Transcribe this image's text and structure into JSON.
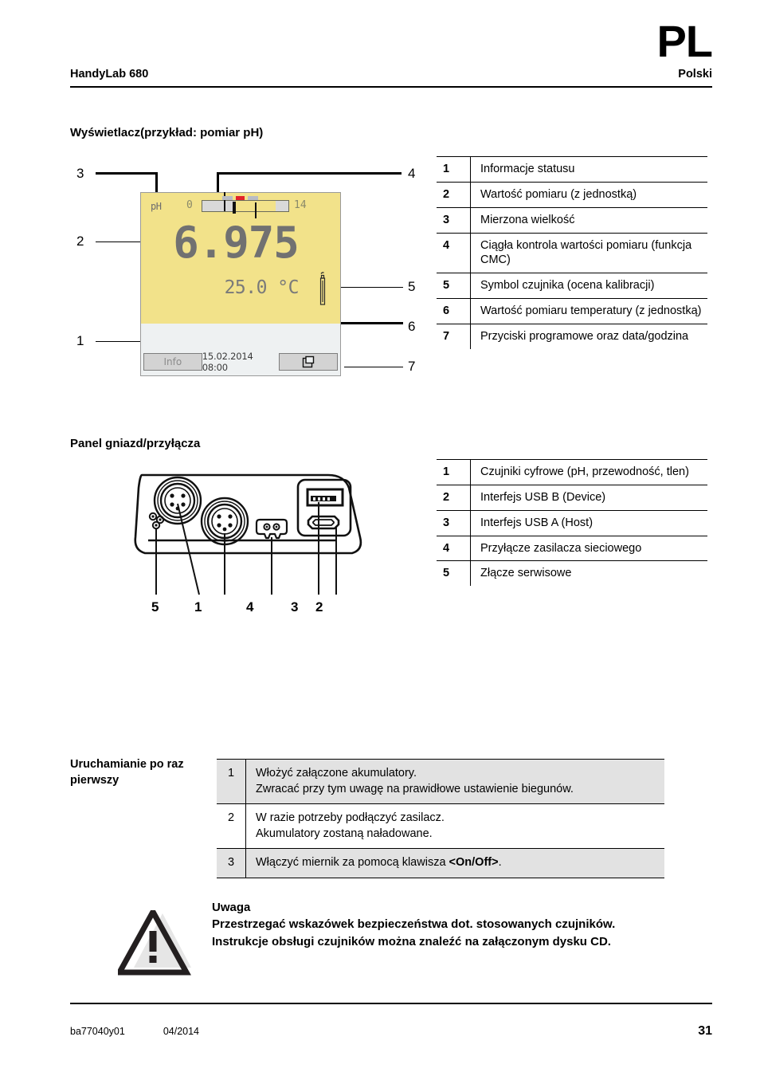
{
  "header": {
    "lang_mark": "PL",
    "product": "HandyLab 680",
    "language": "Polski"
  },
  "display_section": {
    "title": "Wyświetlacz(przykład: pomiar pH)",
    "lcd": {
      "measured_quantity": "pH",
      "scale_min": "0",
      "scale_max": "14",
      "value": "6.975",
      "temperature": "25.0 °C",
      "softkey_left": "Info",
      "datetime": "15.02.2014  08:00",
      "softkey_right_icon": "cascade-windows-icon",
      "sensor_icon": "electrode-sensor-icon",
      "colors": {
        "lcd_background": "#f2e28a",
        "status_background": "#eef1f2",
        "digit_color": "#717171",
        "cmc_marker_red": "#e2222a",
        "cmc_marker_gray": "#b9bcc4"
      }
    },
    "callouts": [
      "1",
      "2",
      "3",
      "4",
      "5",
      "6",
      "7"
    ],
    "legend": [
      {
        "num": "1",
        "text": "Informacje statusu"
      },
      {
        "num": "2",
        "text": "Wartość pomiaru (z jednostką)"
      },
      {
        "num": "3",
        "text": "Mierzona wielkość"
      },
      {
        "num": "4",
        "text": "Ciągła kontrola wartości pomiaru (funkcja CMC)"
      },
      {
        "num": "5",
        "text": "Symbol czujnika (ocena kalibracji)"
      },
      {
        "num": "6",
        "text": "Wartość pomiaru temperatury (z jednostką)"
      },
      {
        "num": "7",
        "text": "Przyciski programowe oraz data/godzina"
      }
    ]
  },
  "panel_section": {
    "title": "Panel gniazd/przyłącza",
    "callouts": [
      "5",
      "1",
      "4",
      "3",
      "2"
    ],
    "legend": [
      {
        "num": "1",
        "text": "Czujniki cyfrowe (pH, przewodność, tlen)"
      },
      {
        "num": "2",
        "text": "Interfejs USB B (Device)"
      },
      {
        "num": "3",
        "text": "Interfejs USB A (Host)"
      },
      {
        "num": "4",
        "text": "Przyłącze zasilacza sieciowego"
      },
      {
        "num": "5",
        "text": "Złącze serwisowe"
      }
    ]
  },
  "startup_section": {
    "label": "Uruchamianie po raz pierwszy",
    "rows": [
      {
        "num": "1",
        "line1": "Włożyć załączone akumulatory.",
        "line2": "Zwracać przy tym uwagę na prawidłowe ustawienie biegunów.",
        "shaded": true
      },
      {
        "num": "2",
        "line1": "W razie potrzeby podłączyć zasilacz.",
        "line2": "Akumulatory zostaną naładowane.",
        "shaded": false
      },
      {
        "num": "3",
        "line1": "Włączyć miernik za pomocą klawisza <On/Off>.",
        "line2": "",
        "shaded": true
      }
    ]
  },
  "warning": {
    "icon": "warning-triangle-icon",
    "title": "Uwaga",
    "line1": "Przestrzegać wskazówek bezpieczeństwa dot. stosowanych czujników.",
    "line2": "Instrukcje obsługi czujników można znaleźć na załączonym dysku CD."
  },
  "footer": {
    "doc_id": "ba77040y01",
    "date": "04/2014",
    "page_number": "31"
  }
}
